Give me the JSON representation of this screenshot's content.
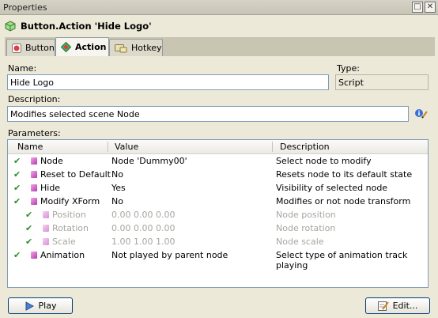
{
  "window": {
    "title": "Properties"
  },
  "header": {
    "text": "Button.Action 'Hide Logo'"
  },
  "tabs": [
    {
      "label": "Button"
    },
    {
      "label": "Action"
    },
    {
      "label": "Hotkey"
    }
  ],
  "form": {
    "name_label": "Name:",
    "name_value": "Hide Logo",
    "type_label": "Type:",
    "type_value": "Script",
    "desc_label": "Description:",
    "desc_value": "Modifies selected scene Node",
    "params_label": "Parameters:"
  },
  "table": {
    "columns": [
      "Name",
      "Value",
      "Description"
    ],
    "rows": [
      {
        "name": "Node",
        "value": "Node 'Dummy00'",
        "desc": "Select node to modify",
        "level": 0,
        "enabled": true
      },
      {
        "name": "Reset to Default",
        "value": "No",
        "desc": "Resets node to its default state",
        "level": 0,
        "enabled": true
      },
      {
        "name": "Hide",
        "value": "Yes",
        "desc": "Visibility of selected node",
        "level": 0,
        "enabled": true
      },
      {
        "name": "Modify XForm",
        "value": "No",
        "desc": "Modifies or not node transform",
        "level": 0,
        "enabled": true
      },
      {
        "name": "Position",
        "value": "0.00  0.00  0.00",
        "desc": "Node position",
        "level": 1,
        "enabled": false
      },
      {
        "name": "Rotation",
        "value": "0.00  0.00  0.00",
        "desc": "Node rotation",
        "level": 1,
        "enabled": false
      },
      {
        "name": "Scale",
        "value": "1.00  1.00  1.00",
        "desc": "Node scale",
        "level": 1,
        "enabled": false
      },
      {
        "name": "Animation",
        "value": "Not played by parent node",
        "desc": "Select type of animation track playing",
        "level": 0,
        "enabled": true
      }
    ]
  },
  "buttons": {
    "play": "Play",
    "edit": "Edit..."
  },
  "colors": {
    "check": "#2b8f2b",
    "node": "#b43cb0",
    "disabled_text": "#a7a6a0"
  }
}
